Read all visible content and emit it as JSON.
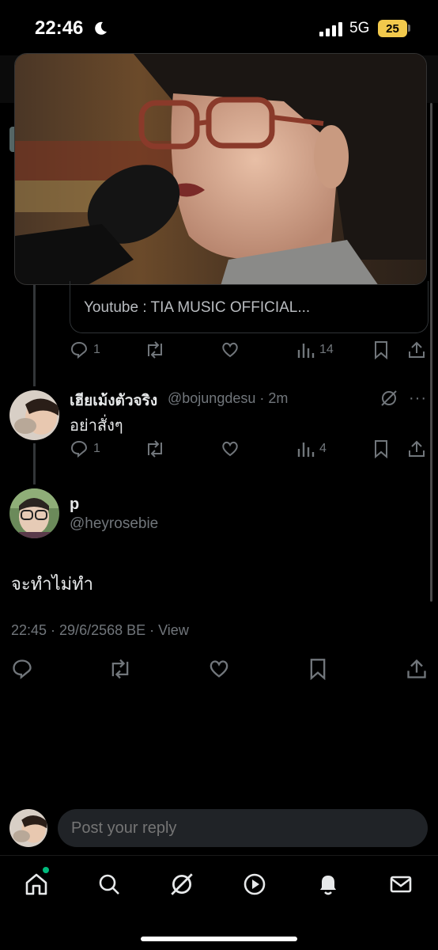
{
  "status_bar": {
    "time": "22:46",
    "network": "5G",
    "battery": "25"
  },
  "card": {
    "caption": "Youtube : TIA MUSIC OFFICIAL..."
  },
  "first_post_actions": {
    "replies": "1",
    "views": "14"
  },
  "reply_post": {
    "display_name": "เฮียเม้งตัวจริง",
    "handle_time": "@bojungdesu · 2m",
    "text": "อย่าสั่งๆ",
    "replies": "1",
    "views": "4"
  },
  "main_post": {
    "display_name": "p",
    "handle": "@heyrosebie",
    "text": "จะทำไม่ทำ",
    "meta": "22:45 · 29/6/2568 BE · View"
  },
  "composer": {
    "placeholder": "Post your reply"
  },
  "nav": {
    "items": [
      "home-icon",
      "search-icon",
      "grok-icon",
      "video-icon",
      "notifications-icon",
      "messages-icon"
    ]
  },
  "colors": {
    "background": "#000000",
    "text_primary": "#e7e9ea",
    "text_secondary": "#71767b",
    "accent_dot": "#00ba7c",
    "battery": "#f2c94c"
  }
}
